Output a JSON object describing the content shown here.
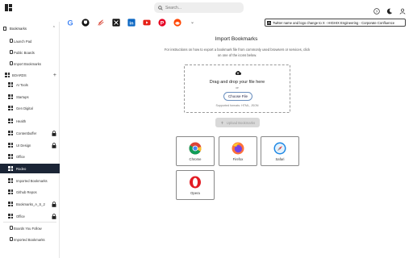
{
  "search": {
    "placeholder": "Search..."
  },
  "sidebar": {
    "bookmarks_header": "Bookmarks",
    "top_items": [
      {
        "label": "Launch Pad"
      },
      {
        "label": "Public Boards"
      },
      {
        "label": "Import Bookmarks"
      }
    ],
    "boards_header": "BOARDS",
    "boards": [
      {
        "label": "AI Tools",
        "locked": false
      },
      {
        "label": "Startups",
        "locked": false
      },
      {
        "label": "Gen Digital",
        "locked": false
      },
      {
        "label": "Health",
        "locked": false
      },
      {
        "label": "Contentbuffer",
        "locked": true
      },
      {
        "label": "UI Design",
        "locked": true
      },
      {
        "label": "Office",
        "locked": false
      },
      {
        "label": "Rodeo",
        "locked": false,
        "active": true
      },
      {
        "label": "Imported Bookmarks",
        "locked": false
      },
      {
        "label": "Github Repos",
        "locked": false
      },
      {
        "label": "Bookmarks_A_S_2",
        "locked": true
      },
      {
        "label": "Office",
        "locked": true
      }
    ],
    "footer_items": [
      {
        "label": "Boards You Follow"
      },
      {
        "label": "Imported Bookmarks"
      }
    ]
  },
  "quick_links": [
    {
      "icon": "google-icon"
    },
    {
      "icon": "github-icon"
    },
    {
      "icon": "leaf-icon"
    },
    {
      "icon": "x-icon"
    },
    {
      "icon": "linkedin-icon"
    },
    {
      "icon": "youtube-icon"
    },
    {
      "icon": "pinterest-icon"
    },
    {
      "icon": "reddit-icon"
    }
  ],
  "current_tab": {
    "label": "Twitter name and logo change to X - HIGHIX Engineering - Corporate Confluence"
  },
  "main": {
    "title": "Import Bookmarks",
    "description": "For instructions on how to export a bookmark file from commonly used browsers or services, click on one of the icons below.",
    "dropzone": {
      "title": "Drag and drop your file here",
      "or": "or",
      "choose_label": "Choose File",
      "formats": "Supported formats: HTML, JSON"
    },
    "upload_label": "Upload Bookmarks",
    "browsers": [
      {
        "name": "Chrome"
      },
      {
        "name": "Firefox"
      },
      {
        "name": "Safari"
      },
      {
        "name": "Opera"
      }
    ]
  },
  "colors": {
    "active_bg": "#1b2536",
    "accent": "#6a8fbf"
  }
}
